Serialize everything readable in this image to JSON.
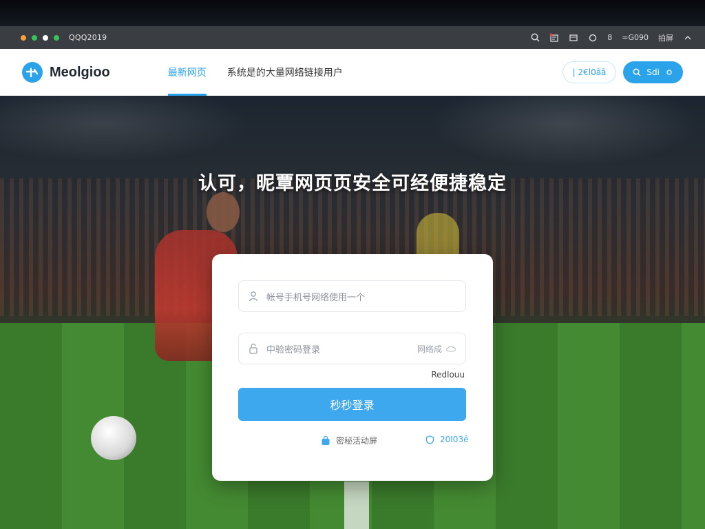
{
  "chrome": {
    "title": "QQQ2019",
    "dot_colors": [
      "#f2a23a",
      "#38c35a",
      "#ffffff",
      "#38c35a"
    ],
    "right_text_1": "8",
    "right_text_2": "≈G090",
    "right_text_3": "拍屏"
  },
  "header": {
    "brand": "Meolgioo",
    "nav": [
      {
        "label": "最新网页",
        "active": true
      },
      {
        "label": "系统是的大量网络链接用户",
        "active": false
      }
    ],
    "outline_button": "| 2€l0āā",
    "filled_button": "Sdi"
  },
  "hero": {
    "title": "认可，昵覃网页页安全可经便捷稳定"
  },
  "login": {
    "username_placeholder": "帐号手机号网络使用一个",
    "password_placeholder": "中验密码登录",
    "password_side": "网络成",
    "forgot": "Redlouu",
    "submit": "秒秒登录",
    "footer_left": "密秘活动屏",
    "footer_right": "20I03ē"
  },
  "colors": {
    "accent": "#2aa3ea",
    "button": "#3ea8ee"
  }
}
